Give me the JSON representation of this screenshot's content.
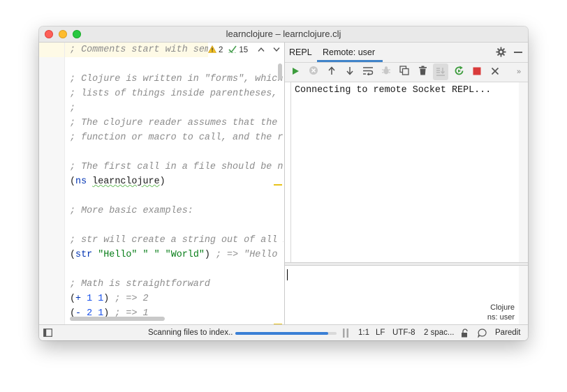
{
  "window": {
    "title": "learnclojure – learnclojure.clj"
  },
  "editor": {
    "inspections": {
      "warning_count": "2",
      "typo_count": "15"
    },
    "lines": [
      [
        {
          "t": "; Comments start with sem",
          "c": "cmt"
        }
      ],
      [],
      [
        {
          "t": "; Clojure is written in \"forms\", which",
          "c": "cmt"
        }
      ],
      [
        {
          "t": "; lists of things inside parentheses, s",
          "c": "cmt"
        }
      ],
      [
        {
          "t": ";",
          "c": "cmt"
        }
      ],
      [
        {
          "t": "; The clojure reader assumes that the f",
          "c": "cmt"
        }
      ],
      [
        {
          "t": "; function or macro to call, and the re",
          "c": "cmt"
        }
      ],
      [],
      [
        {
          "t": "; The first call in a file should be ns",
          "c": "cmt"
        }
      ],
      [
        {
          "t": "(",
          "c": "paren"
        },
        {
          "t": "ns",
          "c": "kw"
        },
        {
          "t": " ",
          "c": "paren"
        },
        {
          "t": "learnclojure",
          "c": "sym"
        },
        {
          "t": ")",
          "c": "paren"
        }
      ],
      [],
      [
        {
          "t": "; More basic examples:",
          "c": "cmt"
        }
      ],
      [],
      [
        {
          "t": "; str will create a string out of all i",
          "c": "cmt"
        }
      ],
      [
        {
          "t": "(",
          "c": "paren"
        },
        {
          "t": "str",
          "c": "kw"
        },
        {
          "t": " ",
          "c": "paren"
        },
        {
          "t": "\"Hello\"",
          "c": "str"
        },
        {
          "t": " ",
          "c": "paren"
        },
        {
          "t": "\" \"",
          "c": "str"
        },
        {
          "t": " ",
          "c": "paren"
        },
        {
          "t": "\"World\"",
          "c": "str"
        },
        {
          "t": ") ",
          "c": "paren"
        },
        {
          "t": "; => \"Hello W",
          "c": "cmt"
        }
      ],
      [],
      [
        {
          "t": "; Math is straightforward",
          "c": "cmt"
        }
      ],
      [
        {
          "t": "(",
          "c": "paren"
        },
        {
          "t": "+",
          "c": "kw"
        },
        {
          "t": " ",
          "c": "paren"
        },
        {
          "t": "1",
          "c": "num"
        },
        {
          "t": " ",
          "c": "paren"
        },
        {
          "t": "1",
          "c": "num"
        },
        {
          "t": ") ",
          "c": "paren"
        },
        {
          "t": "; => 2",
          "c": "cmt"
        }
      ],
      [
        {
          "t": "(",
          "c": "paren"
        },
        {
          "t": "-",
          "c": "kw"
        },
        {
          "t": " ",
          "c": "paren"
        },
        {
          "t": "2",
          "c": "num"
        },
        {
          "t": " ",
          "c": "paren"
        },
        {
          "t": "1",
          "c": "num"
        },
        {
          "t": ") ",
          "c": "paren"
        },
        {
          "t": "; => 1",
          "c": "cmt"
        }
      ]
    ]
  },
  "repl": {
    "tabs": [
      {
        "label": "REPL",
        "active": false
      },
      {
        "label": "Remote: user",
        "active": true
      }
    ],
    "toolbar": [
      "run-icon",
      "stop-circle-icon",
      "arrow-up-icon",
      "arrow-down-icon",
      "soft-wrap-icon",
      "bug-icon",
      "copy-icon",
      "trash-icon",
      "scroll-end-icon",
      "rerun-icon",
      "stop-square-icon",
      "close-icon",
      "more-icon"
    ],
    "output": "Connecting to remote Socket REPL...",
    "input_info": {
      "language": "Clojure",
      "namespace": "ns: user"
    }
  },
  "statusbar": {
    "indexing_text": "Scanning files to index..",
    "progress": 0.92,
    "position": "1:1",
    "line_separator": "LF",
    "encoding": "UTF-8",
    "indent": "2 spac...",
    "mode": "Paredit"
  },
  "colors": {
    "accent": "#4083c9",
    "run_green": "#3d9c3d",
    "stop_red": "#d93b3b",
    "warning": "#e8c21b"
  }
}
